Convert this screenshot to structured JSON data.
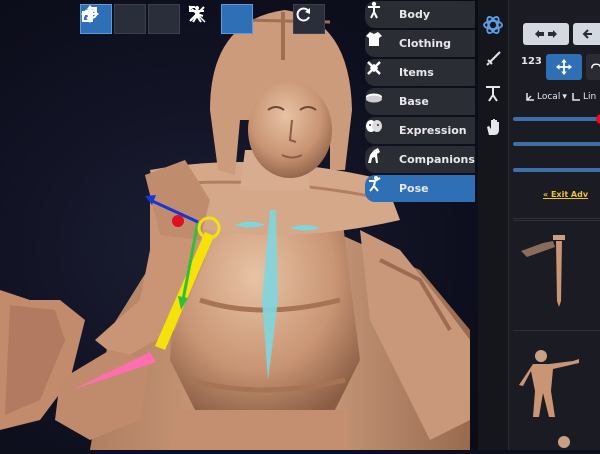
{
  "categories": [
    {
      "label": "Body",
      "icon": "body-icon"
    },
    {
      "label": "Clothing",
      "icon": "clothing-icon"
    },
    {
      "label": "Items",
      "icon": "items-icon"
    },
    {
      "label": "Base",
      "icon": "base-icon"
    },
    {
      "label": "Expression",
      "icon": "expression-icon"
    },
    {
      "label": "Companions",
      "icon": "companions-icon"
    },
    {
      "label": "Pose",
      "icon": "pose-icon"
    }
  ],
  "active_category": "Pose",
  "toolbar": {
    "move_icon": "move-icon",
    "rotate_icon": "rotate-icon",
    "scale_icon": "scale-icon",
    "bone_icon": "bone-icon",
    "ik_icon": "ik-icon",
    "figure_icon": "figure-pose-icon",
    "reset_icon": "reset-icon"
  },
  "panel": {
    "numbers_label": "123",
    "local_label": "Local",
    "link_label": "« Exit Adv",
    "sliders": [
      0.95,
      0.0,
      0.0
    ],
    "thumbnails": [
      "sword-thumbnail",
      "pose-figure-thumbnail"
    ]
  },
  "colors": {
    "accent": "#2f6fb5",
    "panel_bg": "#1b1c23",
    "gizmo_yellow": "#f4e20a",
    "gizmo_blue": "#1a35d6",
    "gizmo_red": "#e01020",
    "selection_cyan": "#7fd6df",
    "selection_pink": "#ff6fb0",
    "link": "#f1c232"
  }
}
